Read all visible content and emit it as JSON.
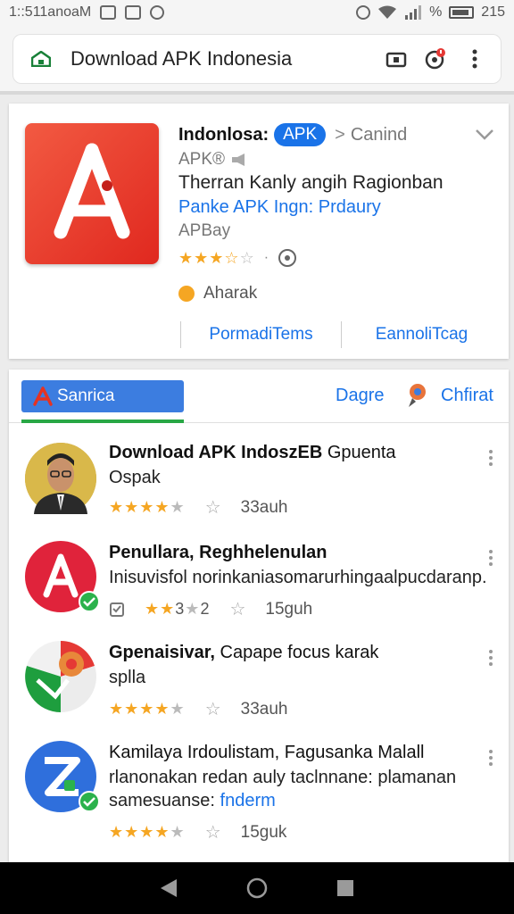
{
  "status_bar": {
    "time": "1::511anoaM",
    "battery": "215",
    "percent": "%"
  },
  "address_bar": {
    "url_title": "Download APK Indonesia"
  },
  "app_card": {
    "title": "Indonlosa:",
    "badge": "APK",
    "breadcrumb": "Canind",
    "subtitle": "APK®",
    "line1": "Therran Kanly angih Ragionban",
    "line2": "Panke APK Ingn: Prdaury",
    "line3": "APBay",
    "rating_stars": 3.5,
    "status": "Aharak",
    "link_left": "PormadiTems",
    "link_right": "EannoliTcag",
    "accent_color": "#e53322"
  },
  "tabs": {
    "active": "Sanrica",
    "second": "Dagre",
    "third": "Chfirat"
  },
  "list": [
    {
      "title": "Download APK IndoszEB",
      "title_rest": " Gpuenta",
      "line": "Ospak",
      "rating_stars": 4,
      "count": "33auh",
      "verified": false
    },
    {
      "title": "Penullara, Reghhelenulan",
      "line": "Inisuvisfol norinkaniasomarurhingaalpucdaranp.",
      "rating_stars": 2.5,
      "rating_text": "3",
      "rating_num": "2",
      "count": "15guh",
      "verified": true
    },
    {
      "title": "Gpenaisivar,",
      "title_rest": " Capape focus karak",
      "line": "splla",
      "rating_stars": 4,
      "count": "33auh",
      "verified": false
    },
    {
      "title_plain": "Kamilaya Irdoulistam, Fagusanka Malall",
      "line": "rlanonakan redan auly taclnnane: plamanan",
      "line2_prefix": "samesuanse:",
      "line2_link": "fnderm",
      "rating_stars": 4,
      "count": "15guk",
      "verified": true
    }
  ]
}
